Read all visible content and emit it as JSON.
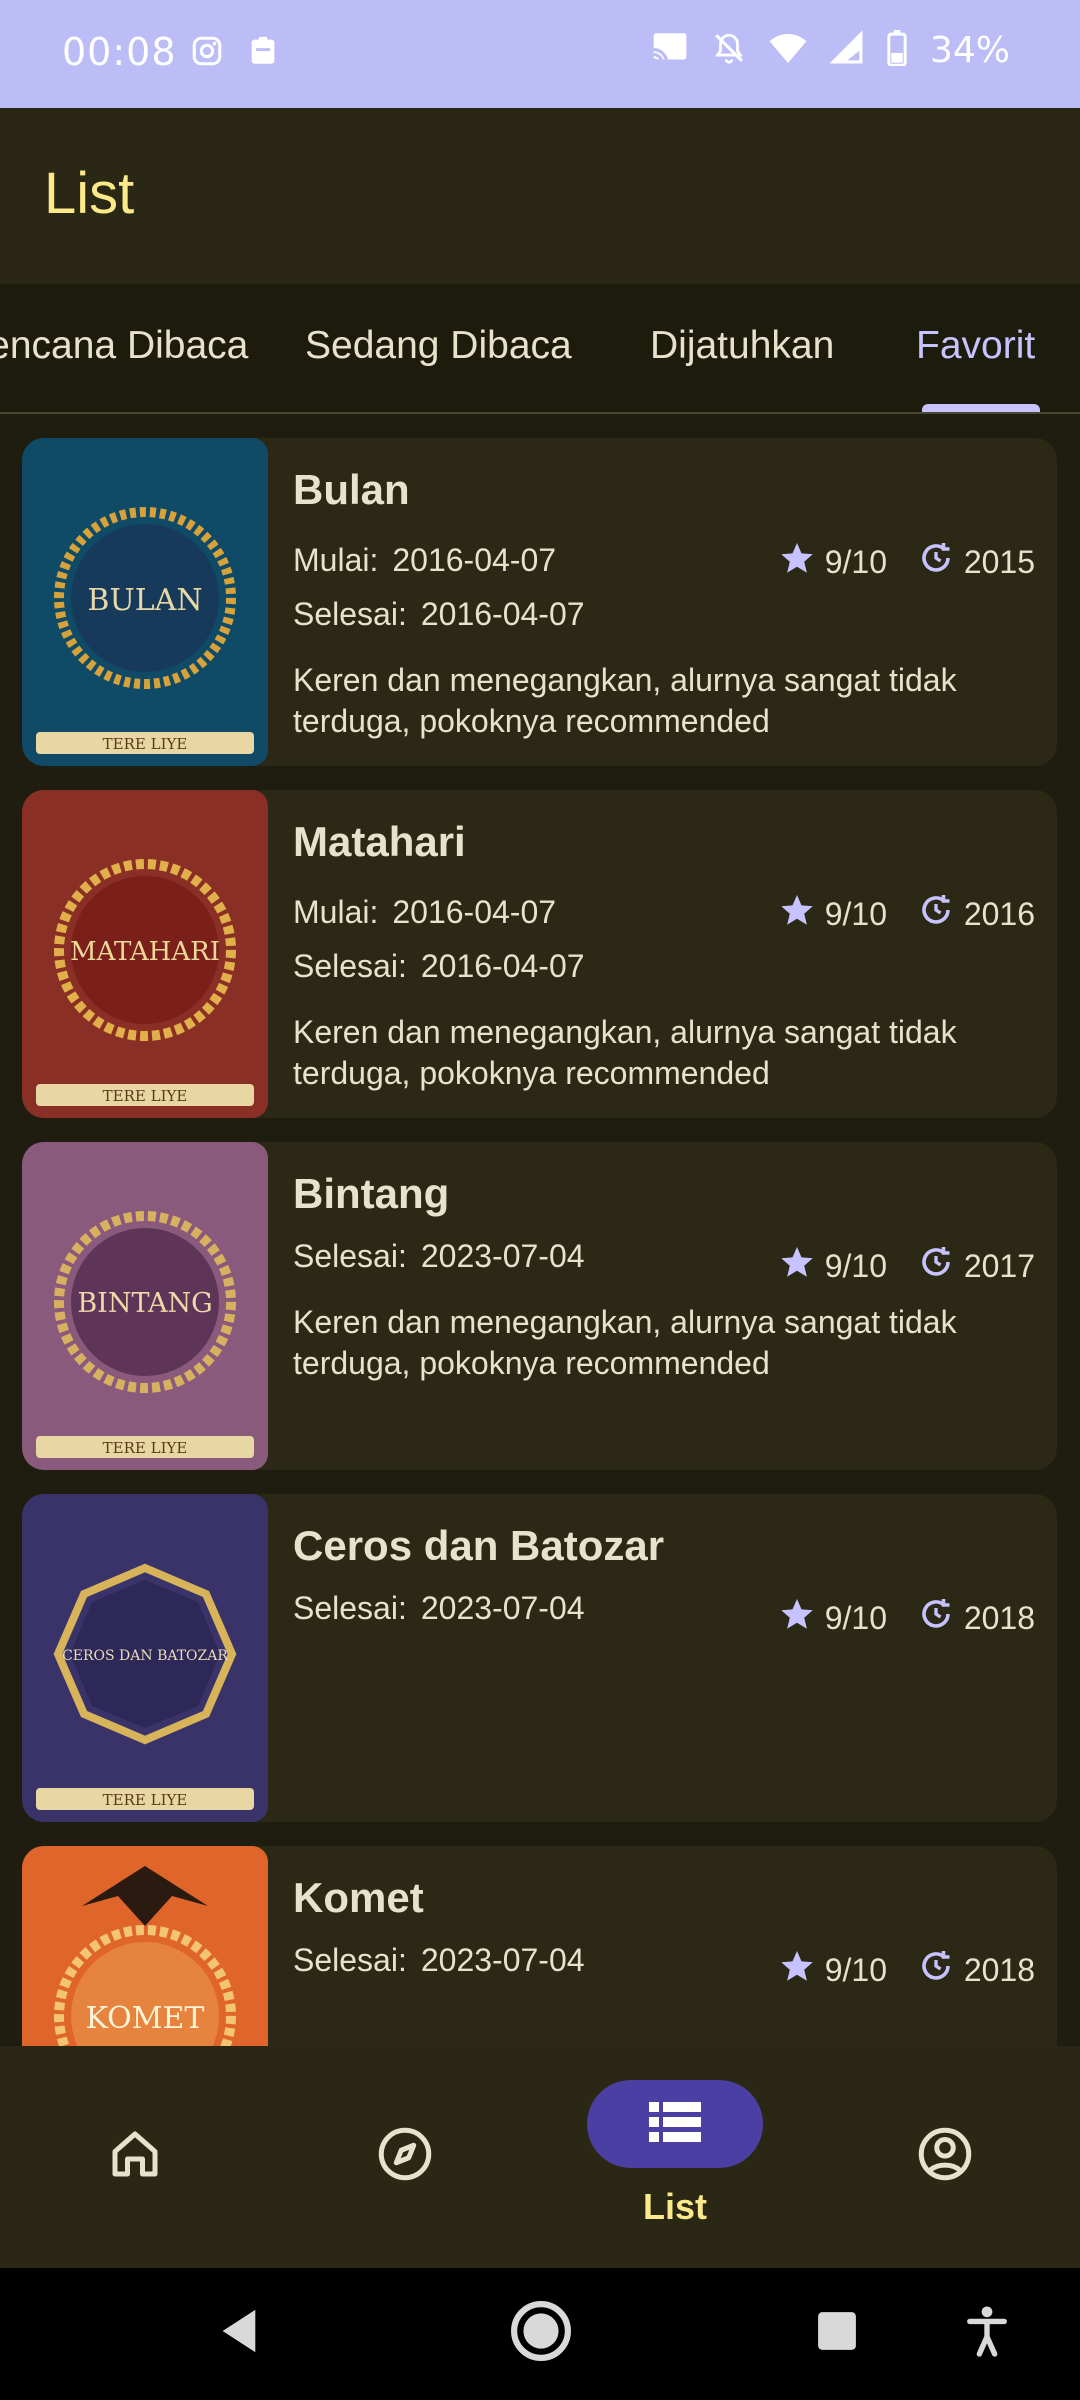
{
  "status_bar": {
    "time": "00:08",
    "battery": "34%",
    "left_icons": [
      "instagram-icon",
      "clipboard-icon"
    ],
    "right_icons": [
      "cast-icon",
      "notifications-off-icon",
      "wifi-icon",
      "signal-icon",
      "battery-icon"
    ]
  },
  "app_bar": {
    "title": "List"
  },
  "tabs": [
    {
      "label": "Rencana Dibaca",
      "active": false
    },
    {
      "label": "Sedang Dibaca",
      "active": false
    },
    {
      "label": "Dijatuhkan",
      "active": false
    },
    {
      "label": "Favorit",
      "active": true
    }
  ],
  "labels": {
    "start": "Mulai:",
    "finish": "Selesai:"
  },
  "books": [
    {
      "title": "Bulan",
      "start": "2016-04-07",
      "finish": "2016-04-07",
      "rating": "9/10",
      "year": "2015",
      "review": "Keren dan menegangkan, alurnya sangat tidak terduga, pokoknya recommended",
      "cover_title": "BULAN",
      "cover_author": "TERE LIYE",
      "cover_bg": "#0f4b67",
      "cover_circle": "#17395a",
      "cover_ring": "#d8a23a"
    },
    {
      "title": "Matahari",
      "start": "2016-04-07",
      "finish": "2016-04-07",
      "rating": "9/10",
      "year": "2016",
      "review": "Keren dan menegangkan, alurnya sangat tidak terduga, pokoknya recommended",
      "cover_title": "MATAHARI",
      "cover_author": "TERE LIYE",
      "cover_bg": "#8a2f25",
      "cover_circle": "#7a1f1a",
      "cover_ring": "#e2b04a"
    },
    {
      "title": "Bintang",
      "finish": "2023-07-04",
      "rating": "9/10",
      "year": "2017",
      "review": "Keren dan menegangkan, alurnya sangat tidak terduga, pokoknya recommended",
      "cover_title": "BINTANG",
      "cover_author": "TERE LIYE",
      "cover_bg": "#8a5a7c",
      "cover_circle": "#5e3558",
      "cover_ring": "#d7b160"
    },
    {
      "title": "Ceros dan Batozar",
      "finish": "2023-07-04",
      "rating": "9/10",
      "year": "2018",
      "cover_title": "CEROS DAN BATOZAR",
      "cover_author": "TERE LIYE",
      "cover_bg": "#3a336a",
      "cover_circle": "#2e2858",
      "cover_ring": "#d7b35a"
    },
    {
      "title": "Komet",
      "finish": "2023-07-04",
      "rating": "9/10",
      "year": "2018",
      "cover_title": "KOMET",
      "cover_author": "",
      "cover_bg": "#e0652a",
      "cover_circle": "#e6833e",
      "cover_ring": "#f3c471"
    }
  ],
  "bottom_nav": [
    {
      "icon": "home-icon",
      "label": "",
      "active": false
    },
    {
      "icon": "compass-icon",
      "label": "",
      "active": false
    },
    {
      "icon": "list-icon",
      "label": "List",
      "active": true
    },
    {
      "icon": "account-icon",
      "label": "",
      "active": false
    }
  ],
  "colors": {
    "status_bar": "#bcbcf6",
    "app_bar": "#2a2714",
    "background": "#1f1d0f",
    "card": "#2b2816",
    "accent": "#c7c3ff",
    "title_yellow": "#fbe98a",
    "nav_pill": "#4b3fa3"
  }
}
